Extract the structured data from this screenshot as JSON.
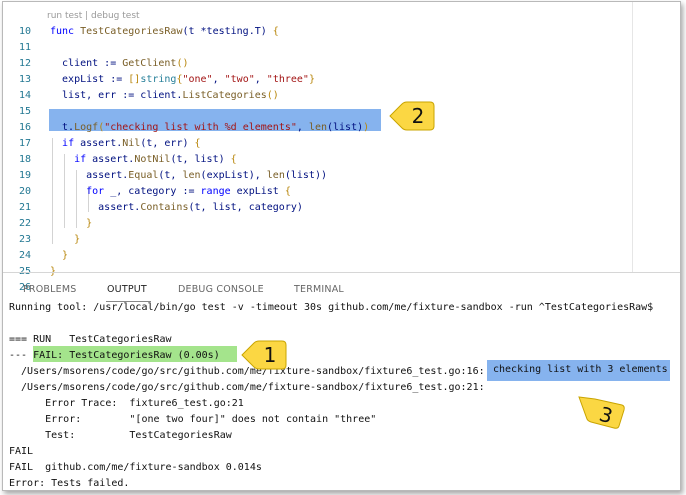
{
  "editor": {
    "codelens": "run test | debug test",
    "line_numbers": [
      "10",
      "11",
      "12",
      "13",
      "14",
      "15",
      "16",
      "17",
      "18",
      "19",
      "20",
      "21",
      "22",
      "23",
      "24",
      "25",
      "26"
    ],
    "lines": [
      [
        {
          "t": "func ",
          "c": "kw"
        },
        {
          "t": "TestCategoriesRaw",
          "c": "fn"
        },
        {
          "t": "(t *testing.T) ",
          "c": "var"
        },
        {
          "t": "{",
          "c": "br"
        }
      ],
      [],
      [
        {
          "t": "  client := ",
          "c": "var"
        },
        {
          "t": "GetClient",
          "c": "fn"
        },
        {
          "t": "()",
          "c": "br"
        }
      ],
      [
        {
          "t": "  expList := ",
          "c": "var"
        },
        {
          "t": "[]",
          "c": "br"
        },
        {
          "t": "string",
          "c": "ty"
        },
        {
          "t": "{",
          "c": "br"
        },
        {
          "t": "\"one\"",
          "c": "str"
        },
        {
          "t": ", ",
          "c": "var"
        },
        {
          "t": "\"two\"",
          "c": "str"
        },
        {
          "t": ", ",
          "c": "var"
        },
        {
          "t": "\"three\"",
          "c": "str"
        },
        {
          "t": "}",
          "c": "br"
        }
      ],
      [
        {
          "t": "  list, err := client.",
          "c": "var"
        },
        {
          "t": "ListCategories",
          "c": "fn"
        },
        {
          "t": "()",
          "c": "br"
        }
      ],
      [],
      [
        {
          "t": "  t.",
          "c": "var"
        },
        {
          "t": "Logf",
          "c": "fn"
        },
        {
          "t": "(",
          "c": "br"
        },
        {
          "t": "\"checking list with %d elements\"",
          "c": "str"
        },
        {
          "t": ", ",
          "c": "var"
        },
        {
          "t": "len",
          "c": "fn"
        },
        {
          "t": "(list)",
          "c": "var"
        },
        {
          "t": ")",
          "c": "br"
        }
      ],
      [
        {
          "t": "  ",
          "c": "var"
        },
        {
          "t": "if ",
          "c": "kw"
        },
        {
          "t": "assert.",
          "c": "var"
        },
        {
          "t": "Nil",
          "c": "fn"
        },
        {
          "t": "(t, err) ",
          "c": "var"
        },
        {
          "t": "{",
          "c": "br"
        }
      ],
      [
        {
          "t": "    ",
          "c": "var"
        },
        {
          "t": "if ",
          "c": "kw"
        },
        {
          "t": "assert.",
          "c": "var"
        },
        {
          "t": "NotNil",
          "c": "fn"
        },
        {
          "t": "(t, list) ",
          "c": "var"
        },
        {
          "t": "{",
          "c": "br"
        }
      ],
      [
        {
          "t": "      assert.",
          "c": "var"
        },
        {
          "t": "Equal",
          "c": "fn"
        },
        {
          "t": "(t, ",
          "c": "var"
        },
        {
          "t": "len",
          "c": "fn"
        },
        {
          "t": "(expList), ",
          "c": "var"
        },
        {
          "t": "len",
          "c": "fn"
        },
        {
          "t": "(list))",
          "c": "var"
        }
      ],
      [
        {
          "t": "      ",
          "c": "var"
        },
        {
          "t": "for ",
          "c": "kw"
        },
        {
          "t": "_, category := ",
          "c": "var"
        },
        {
          "t": "range ",
          "c": "kw"
        },
        {
          "t": "expList ",
          "c": "var"
        },
        {
          "t": "{",
          "c": "br"
        }
      ],
      [
        {
          "t": "        assert.",
          "c": "var"
        },
        {
          "t": "Contains",
          "c": "fn"
        },
        {
          "t": "(t, list, category)",
          "c": "var"
        }
      ],
      [
        {
          "t": "      }",
          "c": "br"
        }
      ],
      [
        {
          "t": "    }",
          "c": "br"
        }
      ],
      [
        {
          "t": "  }",
          "c": "br"
        }
      ],
      [
        {
          "t": "}",
          "c": "br"
        }
      ],
      []
    ]
  },
  "callouts": {
    "one": "1",
    "two": "2",
    "three": "3"
  },
  "panel": {
    "tabs": [
      "PROBLEMS",
      "OUTPUT",
      "DEBUG CONSOLE",
      "TERMINAL"
    ],
    "active_tab": "OUTPUT",
    "output": [
      "Running tool: /usr/local/bin/go test -v -timeout 30s github.com/me/fixture-sandbox -run ^TestCategoriesRaw$",
      "",
      "=== RUN   TestCategoriesRaw",
      "--- FAIL: TestCategoriesRaw (0.00s)",
      "  /Users/msorens/code/go/src/github.com/me/fixture-sandbox/fixture6_test.go:16:",
      "  /Users/msorens/code/go/src/github.com/me/fixture-sandbox/fixture6_test.go:21:",
      "      Error Trace:  fixture6_test.go:21",
      "      Error:        \"[one two four]\" does not contain \"three\"",
      "      Test:         TestCategoriesRaw",
      "FAIL",
      "FAIL  github.com/me/fixture-sandbox 0.014s",
      "Error: Tests failed."
    ],
    "log_message": "checking list with 3 elements"
  },
  "colors": {
    "line_highlight": "#86b3ee",
    "fail_highlight": "#a4e48c",
    "callout_fill": "#fbd743"
  }
}
